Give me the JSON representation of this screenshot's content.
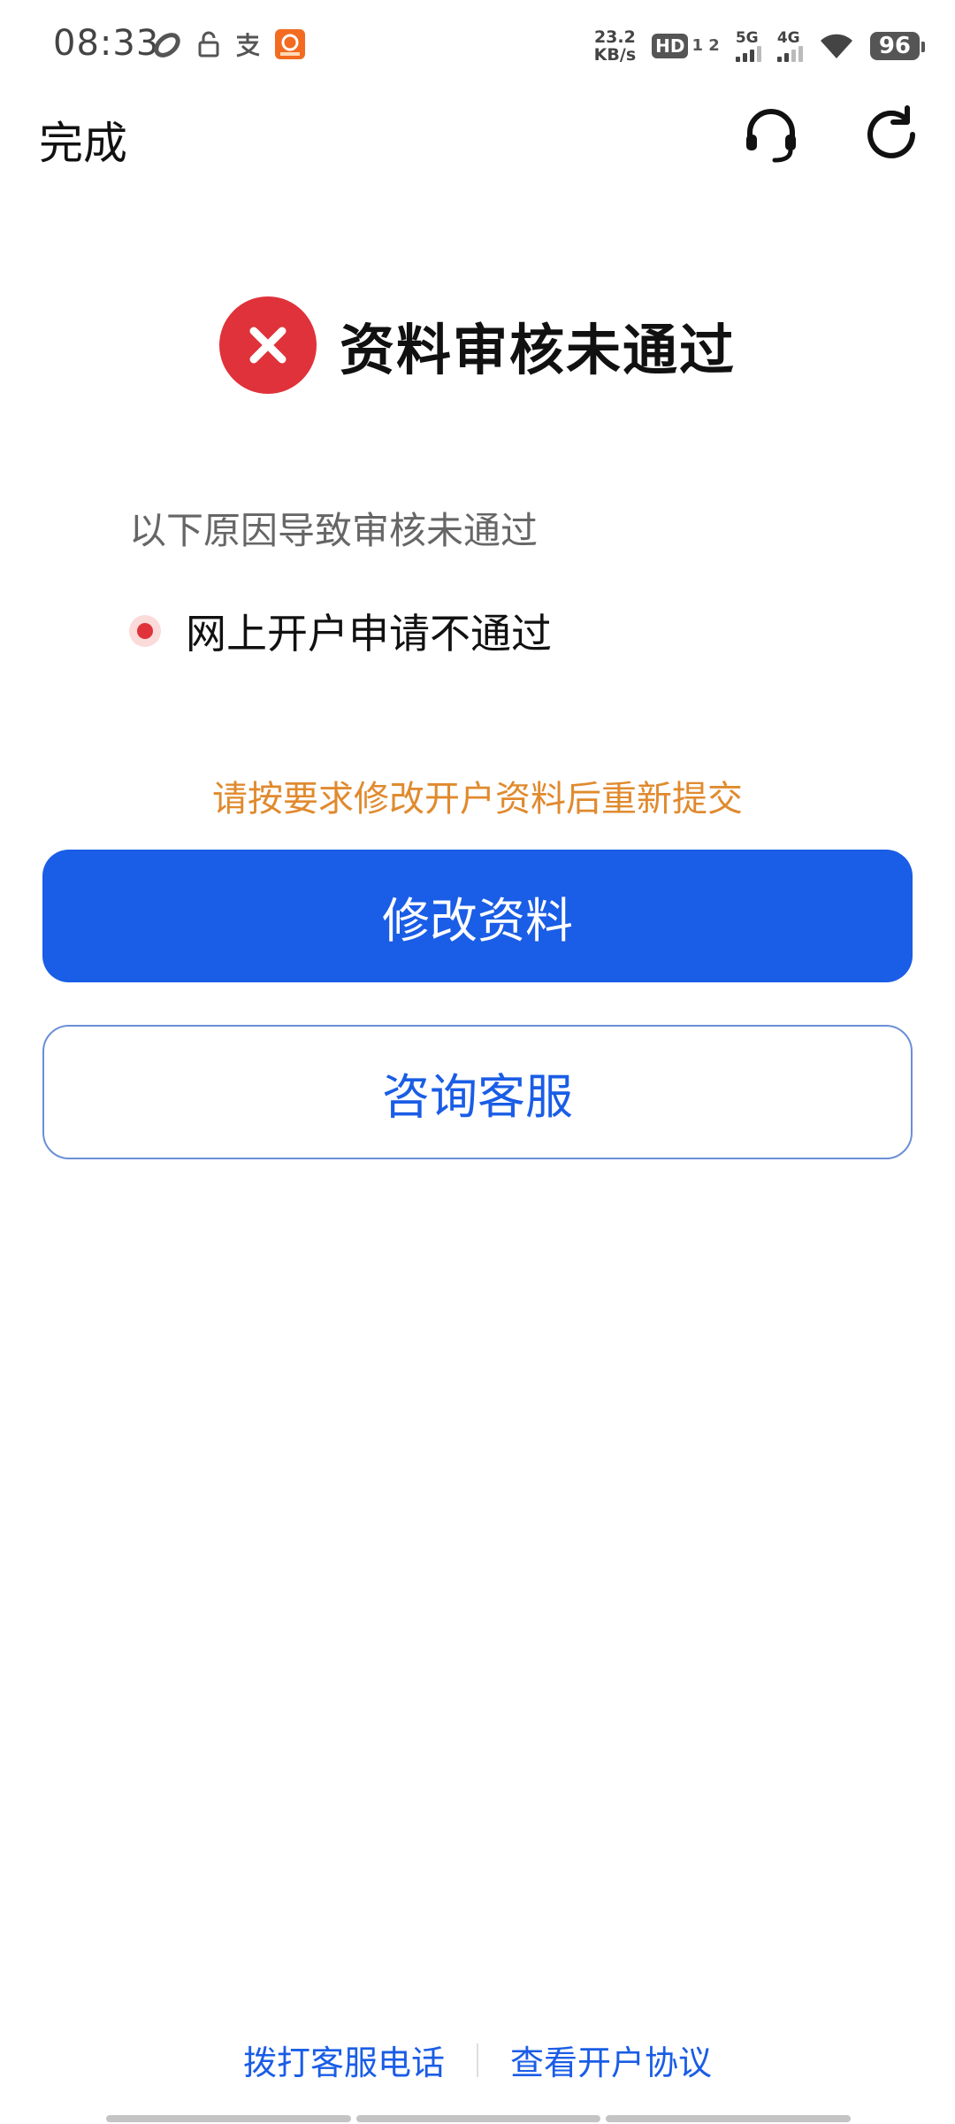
{
  "status_bar": {
    "time": "08:33",
    "net_speed_value": "23.2",
    "net_speed_unit": "KB/s",
    "hd_label": "HD",
    "hd_sub": "1 2",
    "sig1_label": "5G",
    "sig2_label": "4G",
    "battery": "96",
    "icons": [
      "sync-icon",
      "unlock-icon",
      "alipay-icon",
      "app-notification-icon",
      "wifi-icon",
      "battery-icon"
    ]
  },
  "header": {
    "done_label": "完成",
    "icons": [
      "headset-icon",
      "refresh-icon"
    ]
  },
  "result": {
    "title": "资料审核未通过",
    "icon": "close-icon"
  },
  "reasons": {
    "intro": "以下原因导致审核未通过",
    "items": [
      {
        "text": "网上开户申请不通过"
      }
    ]
  },
  "hint": "请按要求修改开户资料后重新提交",
  "buttons": {
    "primary": "修改资料",
    "secondary": "咨询客服"
  },
  "footer": {
    "call_label": "拨打客服电话",
    "agreement_label": "查看开户协议"
  },
  "colors": {
    "primary_blue": "#1a5de6",
    "error_red": "#e0323a",
    "hint_orange": "#e08a2e"
  }
}
